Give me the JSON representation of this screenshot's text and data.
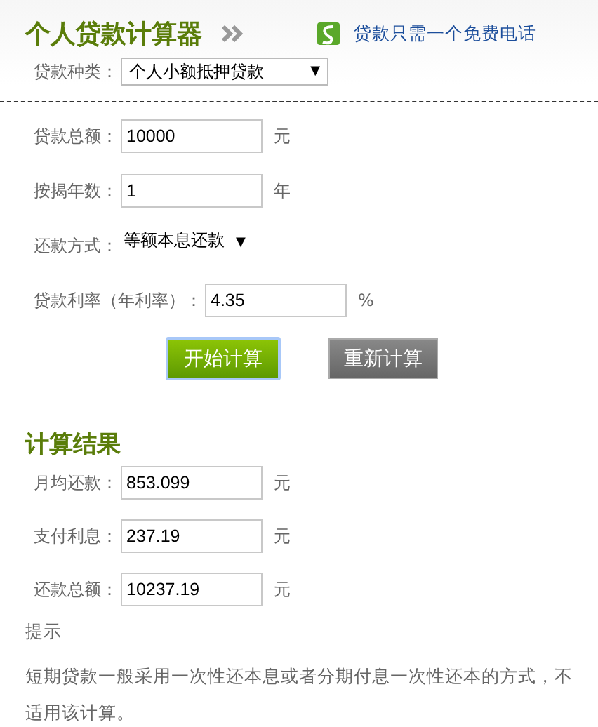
{
  "header": {
    "title": "个人贷款计算器",
    "hotline": "贷款只需一个免费电话"
  },
  "loan_type": {
    "label": "贷款种类：",
    "value": "个人小额抵押贷款",
    "arrow": "▼"
  },
  "inputs": [
    {
      "kind": "input",
      "label": "贷款总额：",
      "value": "10000",
      "unit": "元"
    },
    {
      "kind": "input",
      "label": "按揭年数：",
      "value": "1",
      "unit": "年"
    },
    {
      "kind": "dropdown",
      "label": "还款方式：",
      "value": "等额本息还款",
      "arrow": "▼"
    },
    {
      "kind": "input",
      "label": "贷款利率（年利率）：",
      "value": "4.35",
      "unit": "%"
    }
  ],
  "buttons": [
    {
      "label": "开始计算",
      "kind": "primary"
    },
    {
      "label": "重新计算",
      "kind": "secondary"
    }
  ],
  "results": {
    "title": "计算结果",
    "rows": [
      {
        "label": "月均还款：",
        "value": "853.099",
        "unit": "元"
      },
      {
        "label": "支付利息：",
        "value": "237.19",
        "unit": "元"
      },
      {
        "label": "还款总额：",
        "value": "10237.19",
        "unit": "元"
      }
    ]
  },
  "tip": {
    "title": "提示",
    "text": "短期贷款一般采用一次性还本息或者分期付息一次性还本的方式，不适用该计算。"
  }
}
